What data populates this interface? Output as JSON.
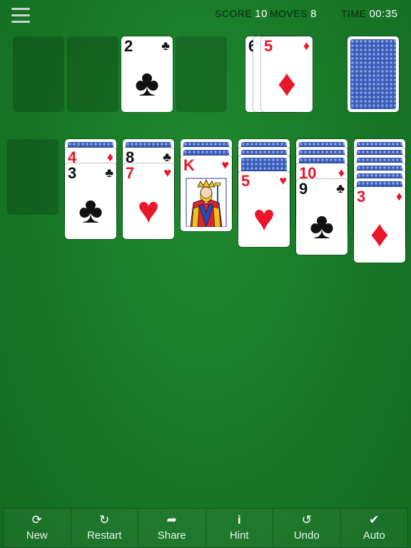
{
  "header": {
    "menu_icon": "hamburger-menu-icon",
    "score_label": "SCORE",
    "score_value": "10",
    "moves_label": "MOVES",
    "moves_value": "8",
    "time_label": "TIME",
    "time_value": "00:35"
  },
  "foundations": [
    {
      "empty": true
    },
    {
      "empty": true
    },
    {
      "rank": "2",
      "suit": "♣",
      "color": "black"
    },
    {
      "empty": true
    }
  ],
  "waste": [
    {
      "rank": "6",
      "suit": "♦",
      "color": "red",
      "visible": "partial"
    },
    {
      "rank": "",
      "suit": "",
      "color": "red",
      "visible": "edge"
    },
    {
      "rank": "5",
      "suit": "♦",
      "color": "red",
      "visible": "full"
    }
  ],
  "stock": {
    "face_down": true
  },
  "tableau": [
    {
      "face_down": 0,
      "face_up": []
    },
    {
      "face_down": 1,
      "face_up": [
        {
          "rank": "4",
          "suit": "♦",
          "color": "red"
        },
        {
          "rank": "3",
          "suit": "♣",
          "color": "black"
        }
      ]
    },
    {
      "face_down": 1,
      "face_up": [
        {
          "rank": "8",
          "suit": "♣",
          "color": "black"
        },
        {
          "rank": "7",
          "suit": "♥",
          "color": "red"
        }
      ]
    },
    {
      "face_down": 2,
      "face_up": [
        {
          "rank": "K",
          "suit": "♥",
          "color": "red",
          "face_card": "king"
        }
      ]
    },
    {
      "face_down": 3,
      "face_up": [
        {
          "rank": "5",
          "suit": "♥",
          "color": "red"
        }
      ]
    },
    {
      "face_down": 4,
      "face_up": [
        {
          "rank": "10",
          "suit": "♦",
          "color": "red"
        },
        {
          "rank": "9",
          "suit": "♣",
          "color": "black"
        }
      ]
    },
    {
      "face_down": 6,
      "face_up": [
        {
          "rank": "3",
          "suit": "♦",
          "color": "red"
        }
      ]
    }
  ],
  "toolbar": [
    {
      "label": "New",
      "icon": "shuffle-icon"
    },
    {
      "label": "Restart",
      "icon": "restart-icon"
    },
    {
      "label": "Share",
      "icon": "share-icon"
    },
    {
      "label": "Hint",
      "icon": "info-icon"
    },
    {
      "label": "Undo",
      "icon": "undo-icon"
    },
    {
      "label": "Auto",
      "icon": "checkmark-icon"
    }
  ],
  "colors": {
    "felt": "#197a28",
    "card_red": "#e8172a",
    "card_back": "#3a5bb8"
  }
}
